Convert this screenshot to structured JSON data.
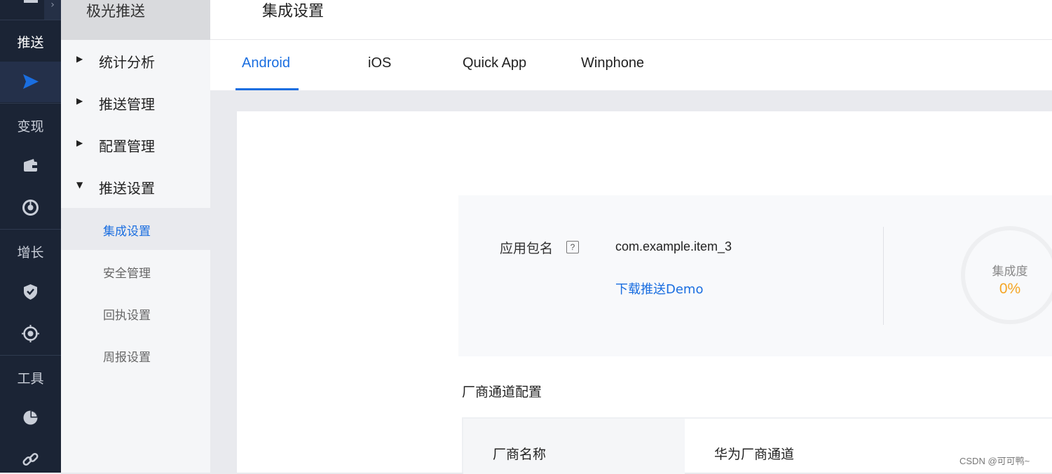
{
  "rail": {
    "groups": [
      "推送",
      "变现",
      "增长",
      "工具"
    ],
    "icons": [
      "home-icon",
      "send-icon",
      "wallet-icon",
      "dial-icon",
      "shield-icon",
      "target-icon",
      "pie-chart-icon",
      "link-icon"
    ]
  },
  "sidebar": {
    "product": "极光推送",
    "items": [
      {
        "label": "统计分析",
        "chevron": "›"
      },
      {
        "label": "推送管理",
        "chevron": "›"
      },
      {
        "label": "配置管理",
        "chevron": "›"
      },
      {
        "label": "推送设置",
        "chevron": "⌄"
      }
    ],
    "subitems": [
      {
        "label": "集成设置",
        "active": true
      },
      {
        "label": "安全管理"
      },
      {
        "label": "回执设置"
      },
      {
        "label": "周报设置"
      }
    ]
  },
  "header": {
    "title": "集成设置"
  },
  "tabs": [
    {
      "label": "Android",
      "active": true
    },
    {
      "label": "iOS"
    },
    {
      "label": "Quick App"
    },
    {
      "label": "Winphone"
    }
  ],
  "info": {
    "package_label": "应用包名",
    "help": "?",
    "package_value": "com.example.item_3",
    "demo_link": "下载推送Demo",
    "progress_label": "集成度",
    "progress_value": "0%"
  },
  "vendor": {
    "section_title": "厂商通道配置",
    "header_label": "厂商名称",
    "value": "华为厂商通道"
  },
  "watermark": "CSDN @可可鸭~",
  "colors": {
    "accent": "#1a6ee0",
    "rail": "#1b2435",
    "progress": "#f5a524"
  }
}
